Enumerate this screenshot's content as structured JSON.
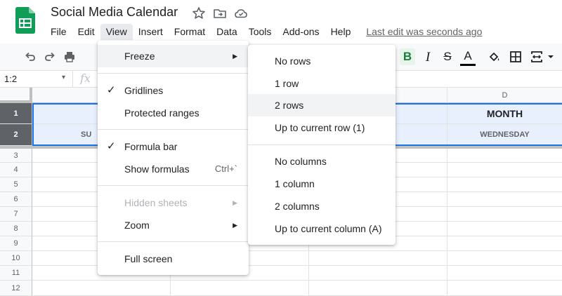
{
  "app": {
    "title": "Social Media Calendar",
    "brand_color": "#0f9d58"
  },
  "menubar": {
    "items": [
      "File",
      "Edit",
      "View",
      "Insert",
      "Format",
      "Data",
      "Tools",
      "Add-ons",
      "Help"
    ],
    "active": "View",
    "last_edit": "Last edit was seconds ago"
  },
  "toolbar": {
    "bold": "B",
    "italic": "I",
    "strikethrough": "S",
    "text_color": "A"
  },
  "formula_bar": {
    "name_box": "1:2",
    "fx": "fx"
  },
  "grid": {
    "columns": [
      {
        "label": ""
      },
      {
        "label": ""
      },
      {
        "label": ""
      },
      {
        "label": "D"
      }
    ],
    "rows": [
      "1",
      "2",
      "3",
      "4",
      "5",
      "6",
      "7",
      "8",
      "9",
      "10",
      "11",
      "12"
    ],
    "selected_rows": [
      "1",
      "2"
    ],
    "cells": {
      "D1": "MONTH",
      "B2": "SU",
      "C2": "",
      "D2": "WEDNESDAY"
    },
    "selection_color": "#1a73e8",
    "highlight_color": "#e8f0fe"
  },
  "view_menu": {
    "items": [
      {
        "label": "Freeze",
        "submenu": true,
        "checked": false,
        "disabled": false
      },
      {
        "label": "Gridlines",
        "checked": true
      },
      {
        "label": "Protected ranges",
        "checked": false
      },
      {
        "label": "Formula bar",
        "checked": true
      },
      {
        "label": "Show formulas",
        "shortcut": "Ctrl+`"
      },
      {
        "label": "Hidden sheets",
        "submenu": true,
        "disabled": true
      },
      {
        "label": "Zoom",
        "submenu": true
      },
      {
        "label": "Full screen"
      }
    ]
  },
  "freeze_menu": {
    "items": [
      {
        "label": "No rows"
      },
      {
        "label": "1 row"
      },
      {
        "label": "2 rows",
        "hovered": true
      },
      {
        "label": "Up to current row (1)"
      },
      {
        "label": "No columns"
      },
      {
        "label": "1 column"
      },
      {
        "label": "2 columns"
      },
      {
        "label": "Up to current column (A)"
      }
    ]
  },
  "icons": [
    "sheets-logo-icon",
    "star-icon",
    "move-to-folder-icon",
    "cloud-saved-icon",
    "undo-icon",
    "redo-icon",
    "print-icon",
    "fill-color-icon",
    "borders-icon",
    "merge-cells-icon",
    "chevron-down-icon",
    "check-icon",
    "submenu-arrow-icon"
  ]
}
